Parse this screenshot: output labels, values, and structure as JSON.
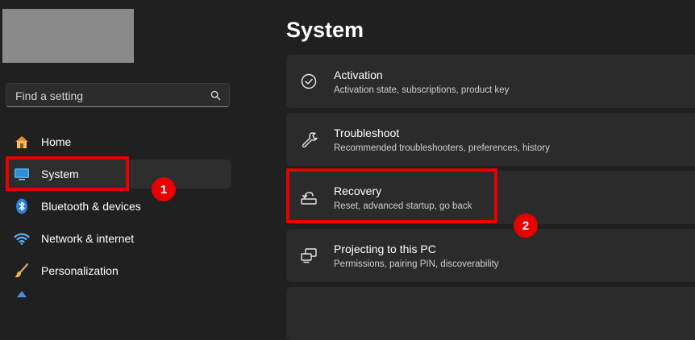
{
  "search": {
    "placeholder": "Find a setting"
  },
  "sidebar": {
    "items": [
      {
        "label": "Home",
        "icon": "home-icon"
      },
      {
        "label": "System",
        "icon": "system-icon",
        "active": true
      },
      {
        "label": "Bluetooth & devices",
        "icon": "bluetooth-icon"
      },
      {
        "label": "Network & internet",
        "icon": "wifi-icon"
      },
      {
        "label": "Personalization",
        "icon": "brush-icon"
      }
    ]
  },
  "main": {
    "title": "System",
    "cards": [
      {
        "title": "Activation",
        "subtitle": "Activation state, subscriptions, product key",
        "icon": "check-circle-icon"
      },
      {
        "title": "Troubleshoot",
        "subtitle": "Recommended troubleshooters, preferences, history",
        "icon": "wrench-icon"
      },
      {
        "title": "Recovery",
        "subtitle": "Reset, advanced startup, go back",
        "icon": "recovery-icon"
      },
      {
        "title": "Projecting to this PC",
        "subtitle": "Permissions, pairing PIN, discoverability",
        "icon": "projecting-icon"
      }
    ]
  },
  "annotations": {
    "step1": "1",
    "step2": "2"
  },
  "colors": {
    "highlight": "#e60000",
    "accent": "#0078d4"
  }
}
